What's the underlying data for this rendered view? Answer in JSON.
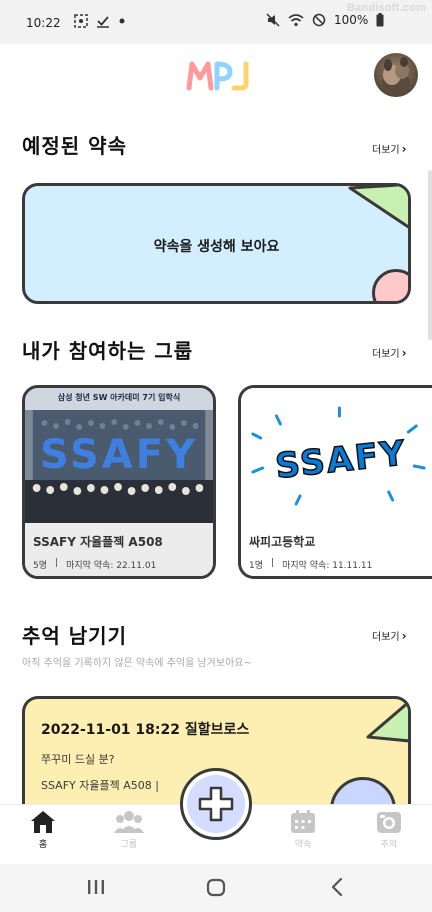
{
  "status_bar": {
    "time": "10:22",
    "battery": "100%"
  },
  "watermark": "Bandisoft.com",
  "header": {
    "logo_text": "MPJ",
    "logo_colors": [
      "#ff9a9a",
      "#8fd3ff",
      "#ffd36b"
    ]
  },
  "sections": {
    "upcoming": {
      "title": "예정된 약속",
      "more": "더보기",
      "empty_card_text": "약속을 생성해 보아요"
    },
    "my_groups": {
      "title": "내가 참여하는 그룹",
      "more": "더보기",
      "groups": [
        {
          "name": "SSAFY 자율플젝 A508",
          "members": "5명",
          "last_promise": "마지막 약속: 22.11.01",
          "photo_banner": "삼성 청년 SW 아카데미 7기 입학식",
          "photo_text": "SSAFY"
        },
        {
          "name": "싸피고등학교",
          "members": "1명",
          "last_promise": "마지막 약속: 11.11.11",
          "photo_text": "SSAFY"
        }
      ]
    },
    "memories": {
      "title": "추억 남기기",
      "more": "더보기",
      "subtitle": "아직 추억을 기록하지 않은 약속에 추억을 남겨보아요~",
      "card": {
        "headline": "2022-11-01 18:22  질할브로스",
        "question": "쭈꾸미 드실 분?",
        "group": "SSAFY 자율플젝 A508  |"
      }
    }
  },
  "bottom_nav": {
    "items": [
      {
        "label": "홈",
        "icon": "home-icon",
        "active": true
      },
      {
        "label": "그룹",
        "icon": "group-icon",
        "active": false
      },
      {
        "label": "약속",
        "icon": "calendar-icon",
        "active": false
      },
      {
        "label": "추억",
        "icon": "camera-icon",
        "active": false
      }
    ],
    "fab_icon": "plus-icon"
  },
  "colors": {
    "promise_card_bg": "#d3efff",
    "memory_card_bg": "#fdeeb1",
    "deco_green": "#c8f0b0",
    "deco_pink": "#ffc9c9",
    "deco_blue": "#c9d6ff",
    "border": "#3a3a3a"
  }
}
